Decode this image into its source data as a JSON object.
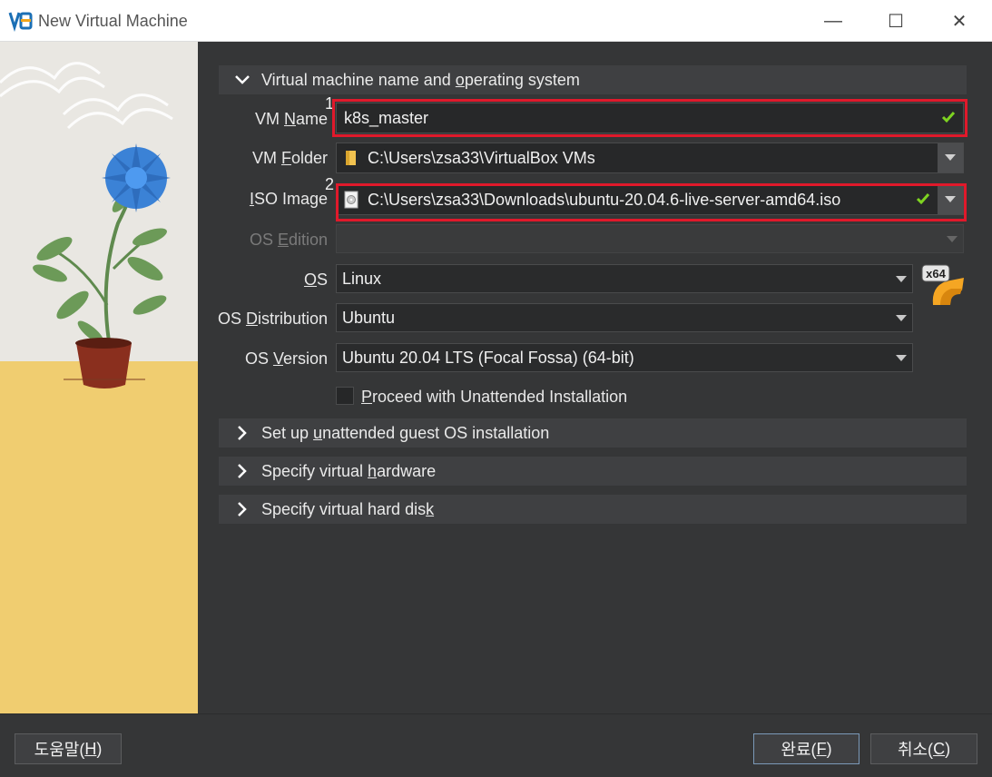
{
  "window": {
    "title": "New Virtual Machine",
    "minimize_glyph": "—",
    "maximize_glyph": "☐",
    "close_glyph": "✕"
  },
  "sections": {
    "name_os": {
      "label_pre": "Virtual machine name and ",
      "label_key": "o",
      "label_post": "perating system",
      "expanded": true
    },
    "unattended": {
      "label_pre": "Set up ",
      "label_key": "u",
      "label_post": "nattended guest OS installation",
      "expanded": false
    },
    "hardware": {
      "label_pre": "Specify virtual ",
      "label_key": "h",
      "label_post": "ardware",
      "expanded": false
    },
    "hard_disk": {
      "label_pre": "Specify virtual hard dis",
      "label_key": "k",
      "label_post": "",
      "expanded": false
    }
  },
  "form": {
    "vm_name": {
      "label_pre": "VM ",
      "label_key": "N",
      "label_post": "ame",
      "value": "k8s_master",
      "valid": true,
      "marker": "1"
    },
    "vm_folder": {
      "label_pre": "VM ",
      "label_key": "F",
      "label_post": "older",
      "value": "C:\\Users\\zsa33\\VirtualBox VMs"
    },
    "iso_image": {
      "label_pre": "",
      "label_key": "I",
      "label_post": "SO Image",
      "value": "C:\\Users\\zsa33\\Downloads\\ubuntu-20.04.6-live-server-amd64.iso",
      "valid": true,
      "marker": "2"
    },
    "os_edition": {
      "label_pre": "OS ",
      "label_key": "E",
      "label_post": "dition",
      "value": "",
      "enabled": false
    },
    "os": {
      "label_pre": "",
      "label_key": "O",
      "label_post": "S",
      "value": "Linux"
    },
    "os_distribution": {
      "label_pre": "OS ",
      "label_key": "D",
      "label_post": "istribution",
      "value": "Ubuntu"
    },
    "os_version": {
      "label_pre": "OS ",
      "label_key": "V",
      "label_post": "ersion",
      "value": "Ubuntu 20.04 LTS (Focal Fossa) (64-bit)"
    },
    "unattended_checkbox": {
      "label_pre": "",
      "label_key": "P",
      "label_post": "roceed with Unattended Installation",
      "checked": false
    }
  },
  "os_badge": "x64",
  "footer": {
    "help": {
      "label_pre": "도움말(",
      "label_key": "H",
      "label_post": ")"
    },
    "finish": {
      "label_pre": "완료(",
      "label_key": "F",
      "label_post": ")"
    },
    "cancel": {
      "label_pre": "취소(",
      "label_key": "C",
      "label_post": ")"
    }
  },
  "colors": {
    "highlight_box": "#e0192b",
    "valid_check": "#7ed321",
    "background": "#353637"
  }
}
